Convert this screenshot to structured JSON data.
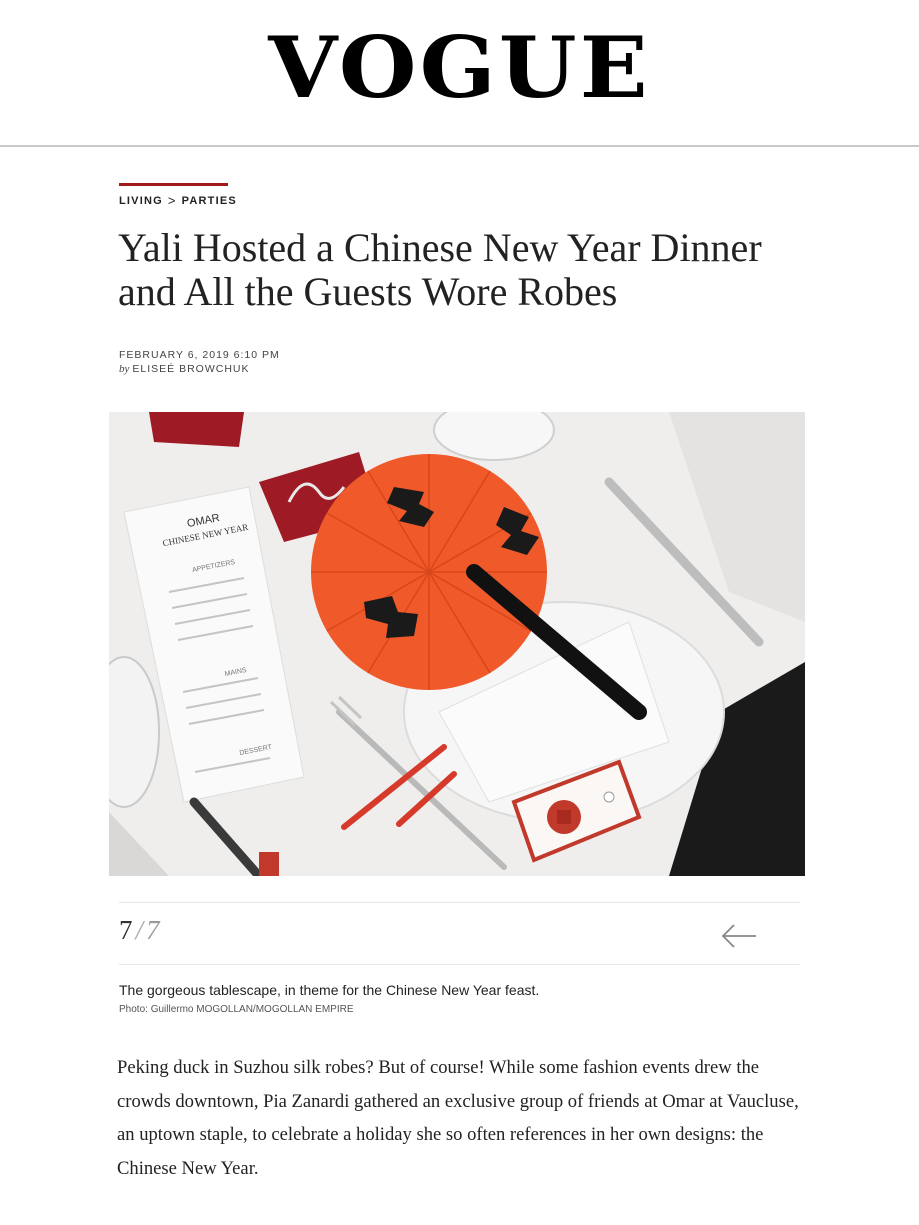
{
  "masthead": {
    "logo": "VOGUE"
  },
  "rubric": {
    "section": "LIVING",
    "separator": ">",
    "subsection": "PARTIES"
  },
  "article": {
    "title": "Yali Hosted a Chinese New Year Dinner and All the Guests Wore Robes",
    "date": "FEBRUARY 6, 2019 6:10 PM",
    "byline_prefix": "by",
    "author": "ELISEÉ BROWCHUK",
    "body": "Peking duck in Suzhou silk robes? But of course! While some fashion events drew the crowds downtown, Pia Zanardi gathered an exclusive group of friends at Omar at Vaucluse, an uptown staple, to celebrate a holiday she so often references in her own designs: the Chinese New Year."
  },
  "gallery": {
    "current": "7",
    "separator": "/",
    "total": "7",
    "prev_icon": "arrow-left-icon",
    "caption": "The gorgeous tablescape, in theme for the Chinese New Year feast.",
    "credit": "Photo: Guillermo MOGOLLAN/MOGOLLAN EMPIRE"
  },
  "photo": {
    "menu_brand": "OMAR",
    "menu_title": "CHINESE NEW YEAR",
    "menu_sections": [
      "APPETIZERS",
      "MAINS",
      "DESSERT"
    ]
  },
  "colors": {
    "accent": "#a11b1b",
    "fan": "#f05a2a",
    "text": "#1a1a1a"
  }
}
